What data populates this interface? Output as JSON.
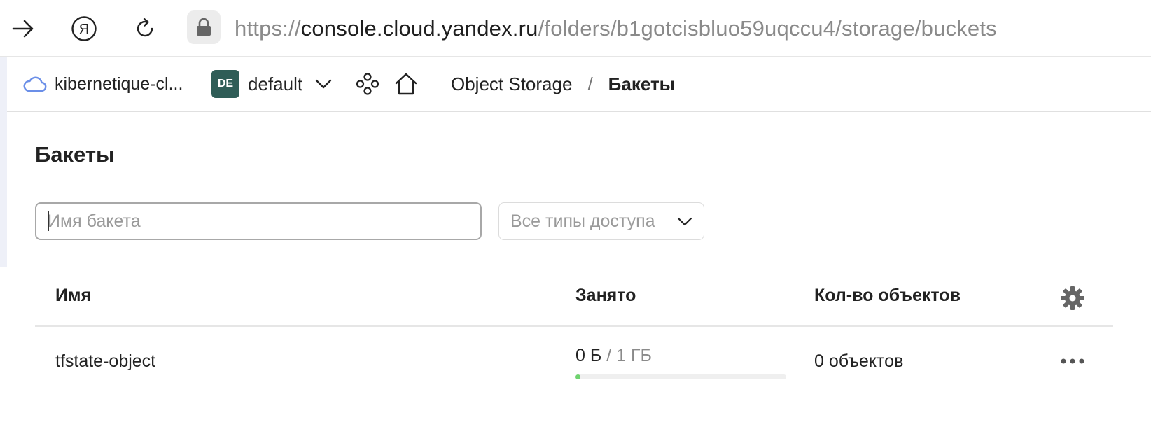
{
  "browser": {
    "url_scheme": "https://",
    "url_host": "console.cloud.yandex.ru",
    "url_path": "/folders/b1gotcisbluo59uqccu4/storage/buckets",
    "yandex_glyph": "Я"
  },
  "header": {
    "cloud_name": "kibernetique-cl...",
    "folder_badge": "DE",
    "folder_name": "default",
    "breadcrumb": {
      "service": "Object Storage",
      "separator": "/",
      "current": "Бакеты"
    }
  },
  "page": {
    "title": "Бакеты",
    "search": {
      "placeholder": "Имя бакета",
      "value": ""
    },
    "access_filter": {
      "selected": "Все типы доступа"
    }
  },
  "table": {
    "columns": [
      "Имя",
      "Занято",
      "Кол-во объектов"
    ],
    "rows": [
      {
        "name": "tfstate-object",
        "used": "0 Б",
        "separator": " / ",
        "quota": "1 ГБ",
        "usage_fraction": 0,
        "objects": "0 объектов"
      }
    ]
  },
  "colors": {
    "accent": "#2f5d57",
    "progress": "#6fd36f",
    "cloud_icon": "#6b8fe8"
  },
  "icons": [
    "forward-arrow-icon",
    "yandex-logo-icon",
    "reload-icon",
    "lock-icon",
    "cloud-icon",
    "chevron-down-icon",
    "services-icon",
    "home-icon",
    "gear-icon",
    "more-icon"
  ]
}
